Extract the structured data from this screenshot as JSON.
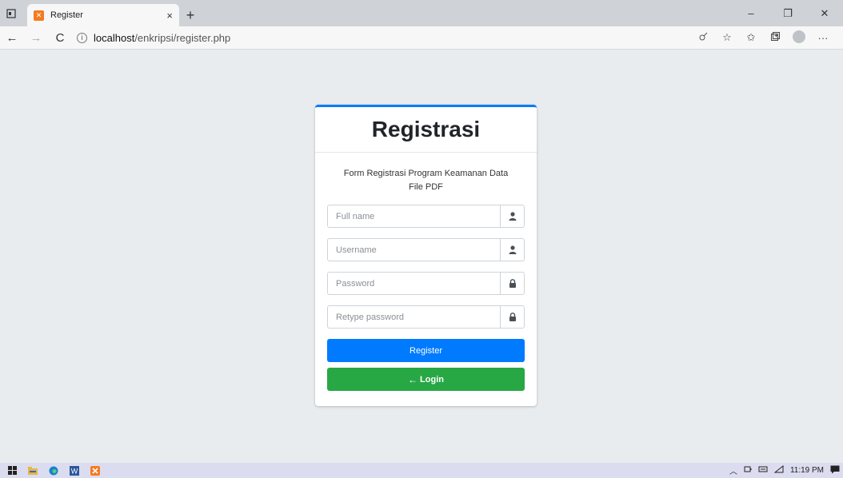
{
  "browser": {
    "tab_title": "Register",
    "tab_favicon": "XAMPP",
    "tab_close": "×",
    "new_tab": "+",
    "url_host": "localhost",
    "url_path": "/enkripsi/register.php",
    "window_controls": {
      "minimize": "–",
      "maximize": "❐",
      "close": "✕"
    },
    "nav": {
      "back": "←",
      "forward": "→",
      "refresh": "C"
    },
    "more_menu": "···"
  },
  "form": {
    "heading": "Registrasi",
    "message": "Form Registrasi Program Keamanan Data File PDF",
    "fields": [
      {
        "placeholder": "Full name",
        "icon": "user-icon"
      },
      {
        "placeholder": "Username",
        "icon": "user-icon"
      },
      {
        "placeholder": "Password",
        "icon": "lock-icon"
      },
      {
        "placeholder": "Retype password",
        "icon": "lock-icon"
      }
    ],
    "register_label": "Register",
    "login_label": "Login",
    "colors": {
      "primary": "#007bff",
      "success": "#28a745",
      "card_accent": "#007bff"
    }
  },
  "taskbar": {
    "time": "11:19 PM",
    "word_label": "W",
    "xampp_label": "XAMPP"
  }
}
